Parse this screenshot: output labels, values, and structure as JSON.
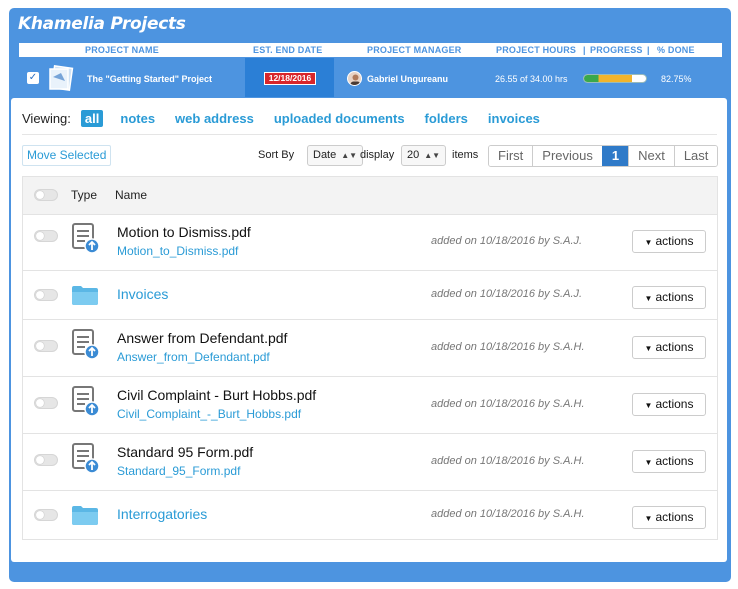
{
  "app": {
    "title": "Khamelia Projects"
  },
  "columns": {
    "project_name": "PROJECT NAME",
    "end_date": "EST. END DATE",
    "manager": "PROJECT MANAGER",
    "hours": "PROJECT HOURS",
    "progress": "PROGRESS",
    "pct_done": "% DONE"
  },
  "project": {
    "name": "The \"Getting Started\" Project",
    "end_date": "12/18/2016",
    "manager": "Gabriel Ungureanu",
    "hours": "26.55 of 34.00 hrs",
    "progress_fraction": 0.78,
    "pct_done": "82.75%"
  },
  "viewing": {
    "label": "Viewing:",
    "filters": [
      "all",
      "notes",
      "web address",
      "uploaded documents",
      "folders",
      "invoices"
    ]
  },
  "toolbar": {
    "move_selected": "Move Selected",
    "sort_by_label": "Sort By",
    "sort_by_value": "Date",
    "display_label": "display",
    "display_value": "20",
    "items_label": "items"
  },
  "pager": {
    "first": "First",
    "previous": "Previous",
    "current": "1",
    "next": "Next",
    "last": "Last"
  },
  "table": {
    "headers": {
      "type": "Type",
      "name": "Name"
    },
    "action_label": "actions",
    "rows": [
      {
        "kind": "document",
        "title": "Motion to Dismiss.pdf",
        "file": "Motion_to_Dismiss.pdf",
        "added": "added on 10/18/2016 by S.A.J."
      },
      {
        "kind": "folder",
        "title": "Invoices",
        "added": "added on 10/18/2016 by S.A.J."
      },
      {
        "kind": "document",
        "title": "Answer from Defendant.pdf",
        "file": "Answer_from_Defendant.pdf",
        "added": "added on 10/18/2016 by S.A.H."
      },
      {
        "kind": "document",
        "title": "Civil Complaint - Burt Hobbs.pdf",
        "file": "Civil_Complaint_-_Burt_Hobbs.pdf",
        "added": "added on 10/18/2016 by S.A.H."
      },
      {
        "kind": "document",
        "title": "Standard 95 Form.pdf",
        "file": "Standard_95_Form.pdf",
        "added": "added on 10/18/2016 by S.A.H."
      },
      {
        "kind": "folder",
        "title": "Interrogatories",
        "added": "added on 10/18/2016 by S.A.H."
      }
    ]
  },
  "colors": {
    "frame": "#4d94e0",
    "accent": "#2a9bd6",
    "date_badge": "#d8262b",
    "pager_active": "#2f7ac8"
  }
}
